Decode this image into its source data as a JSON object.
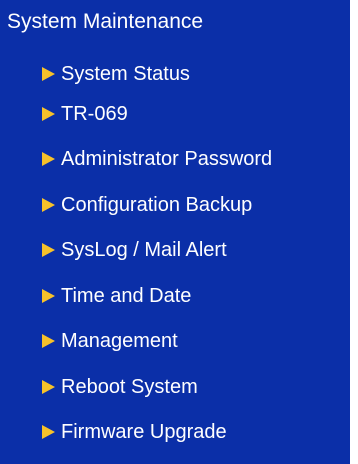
{
  "panel": {
    "title": "System Maintenance",
    "items": [
      {
        "label": "System Status"
      },
      {
        "label": "TR-069"
      },
      {
        "label": "Administrator Password"
      },
      {
        "label": "Configuration Backup"
      },
      {
        "label": "SysLog / Mail Alert"
      },
      {
        "label": "Time and Date"
      },
      {
        "label": "Management"
      },
      {
        "label": "Reboot System"
      },
      {
        "label": "Firmware Upgrade"
      }
    ]
  },
  "icons": {
    "bullet": "arrow-right-icon"
  },
  "colors": {
    "background": "#0b2fa8",
    "text": "#ffffff",
    "bullet": "#f7c22a"
  }
}
